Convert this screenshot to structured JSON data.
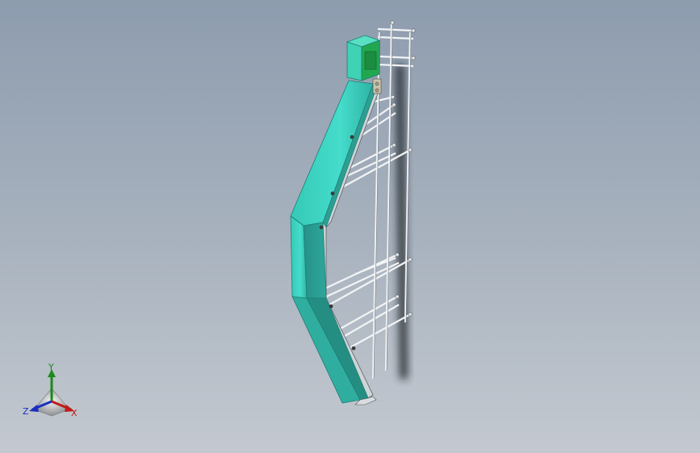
{
  "viewport": {
    "background_top": "#8d9cae",
    "background_bottom": "#c4c9d0"
  },
  "model": {
    "icon": "conveyor-model-icon",
    "chute_color": "#3fd6c4",
    "chute_shadow_color": "#2a9c91",
    "head_box_color": "#2fcfa9",
    "frame_color": "#e8ecef",
    "bolt_color": "#3a3a3a"
  },
  "triad": {
    "icon": "coordinate-triad-icon",
    "labels": {
      "x": "X",
      "y": "Y",
      "z": "Z"
    },
    "colors": {
      "x": "#c01a1a",
      "y": "#1a8a1a",
      "z": "#1a2fc0"
    }
  }
}
